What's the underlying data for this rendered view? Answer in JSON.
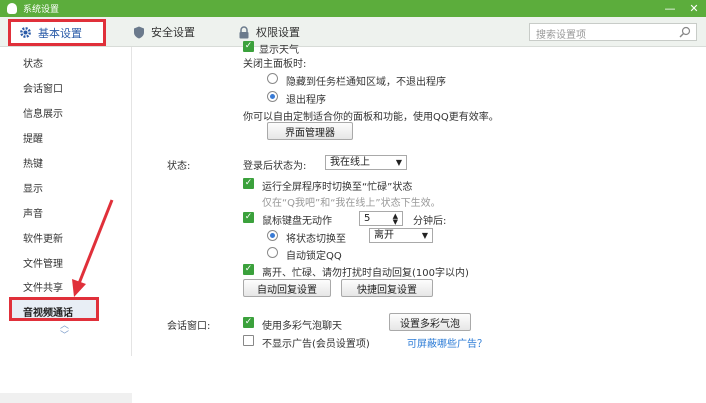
{
  "window": {
    "title": "系统设置",
    "minimize": "—",
    "close": "✕"
  },
  "tabs": [
    {
      "label": "基本设置",
      "icon": "gear-icon"
    },
    {
      "label": "安全设置",
      "icon": "shield-icon"
    },
    {
      "label": "权限设置",
      "icon": "lock-icon"
    }
  ],
  "search": {
    "placeholder": "搜索设置项",
    "icon": "search-icon"
  },
  "sidebar": {
    "items": [
      {
        "label": "状态"
      },
      {
        "label": "会话窗口"
      },
      {
        "label": "信息展示"
      },
      {
        "label": "提醒"
      },
      {
        "label": "热键"
      },
      {
        "label": "显示"
      },
      {
        "label": "声音"
      },
      {
        "label": "软件更新"
      },
      {
        "label": "文件管理"
      },
      {
        "label": "文件共享"
      },
      {
        "label": "音视频通话"
      }
    ],
    "active_index": 10,
    "scroll_up": "︿",
    "scroll_down": "﹀"
  },
  "main": {
    "top_partial": "显示天气",
    "close_panel_label": "关闭主面板时:",
    "close_opt_hide": "隐藏到任务栏通知区域，不退出程序",
    "close_opt_exit": "退出程序",
    "close_opt_selected": "exit",
    "customize_text": "你可以自由定制适合你的面板和功能，使用QQ更有效率。",
    "interface_manager_button": "界面管理器",
    "status_section_label": "状态:",
    "login_status_label": "登录后状态为:",
    "login_status_value": "我在线上",
    "fullscreen_busy": "运行全屏程序时切换至“忙碌”状态",
    "fullscreen_busy_checked": true,
    "fullscreen_note": "仅在“Q我吧”和“我在线上”状态下生效。",
    "idle_label": "鼠标键盘无动作",
    "idle_checked": true,
    "idle_minutes": "5",
    "idle_unit": "分钟后:",
    "idle_switch_label": "将状态切换至",
    "idle_switch_value": "离开",
    "idle_lock_label": "自动锁定QQ",
    "idle_option_selected": "switch",
    "auto_reply_label": "离开、忙碌、请勿打扰时自动回复(100字以内)",
    "auto_reply_checked": true,
    "auto_reply_button": "自动回复设置",
    "quick_reply_button": "快捷回复设置",
    "chat_section_label": "会话窗口:",
    "bubble_label": "使用多彩气泡聊天",
    "bubble_checked": true,
    "bubble_button": "设置多彩气泡",
    "no_ads_label": "不显示广告(会员设置项)",
    "no_ads_checked": false,
    "no_ads_link": "可屏蔽哪些广告？"
  },
  "colors": {
    "titlebar": "#5cad3c",
    "annotation_red": "#e0303a",
    "checkbox_green": "#3ba13c",
    "link_blue": "#2b7bd6"
  }
}
